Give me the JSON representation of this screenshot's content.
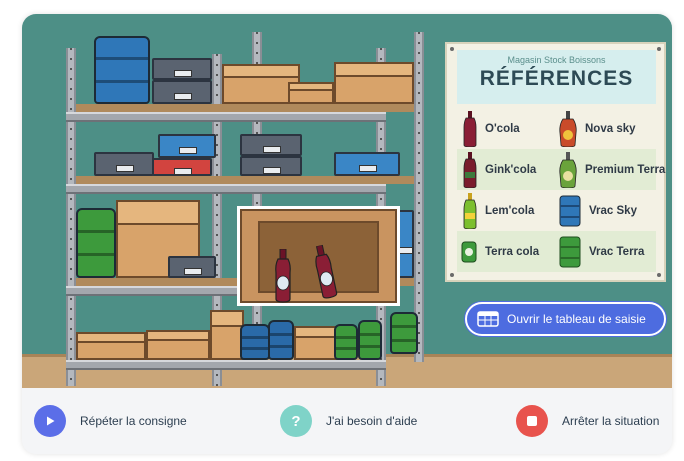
{
  "scene": {
    "references": {
      "subtitle": "Magasin Stock Boissons",
      "title": "RÉFÉRENCES",
      "items": [
        {
          "label": "O'cola",
          "icon": "cola-bottle-icon",
          "color": "#8a1e35"
        },
        {
          "label": "Nova sky",
          "icon": "nova-sky-bottle-icon",
          "color": "#c94b2a"
        },
        {
          "label": "Gink'cola",
          "icon": "ginkcola-bottle-icon",
          "color": "#7a1c2c"
        },
        {
          "label": "Premium Terra",
          "icon": "premium-terra-bottle-icon",
          "color": "#6aa33b"
        },
        {
          "label": "Lem'cola",
          "icon": "lemcola-bottle-icon",
          "color": "#7cbf2e"
        },
        {
          "label": "Vrac Sky",
          "icon": "vrac-sky-drum-icon",
          "color": "#2f77b8"
        },
        {
          "label": "Terra cola",
          "icon": "terra-cola-can-icon",
          "color": "#3d9a3c"
        },
        {
          "label": "Vrac Terra",
          "icon": "vrac-terra-drum-icon",
          "color": "#3d9a3c"
        }
      ]
    },
    "open_table_button": {
      "label": "Ouvrir le tableau de saisie",
      "icon": "table-icon"
    }
  },
  "actions": {
    "repeat": {
      "label": "Répéter la consigne",
      "icon": "play-icon",
      "color": "#5b6ee8"
    },
    "help": {
      "label": "J'ai besoin d'aide",
      "icon": "question-icon",
      "color": "#7fd3c8"
    },
    "stop": {
      "label": "Arrêter la situation",
      "icon": "stop-icon",
      "color": "#e8534d"
    }
  }
}
